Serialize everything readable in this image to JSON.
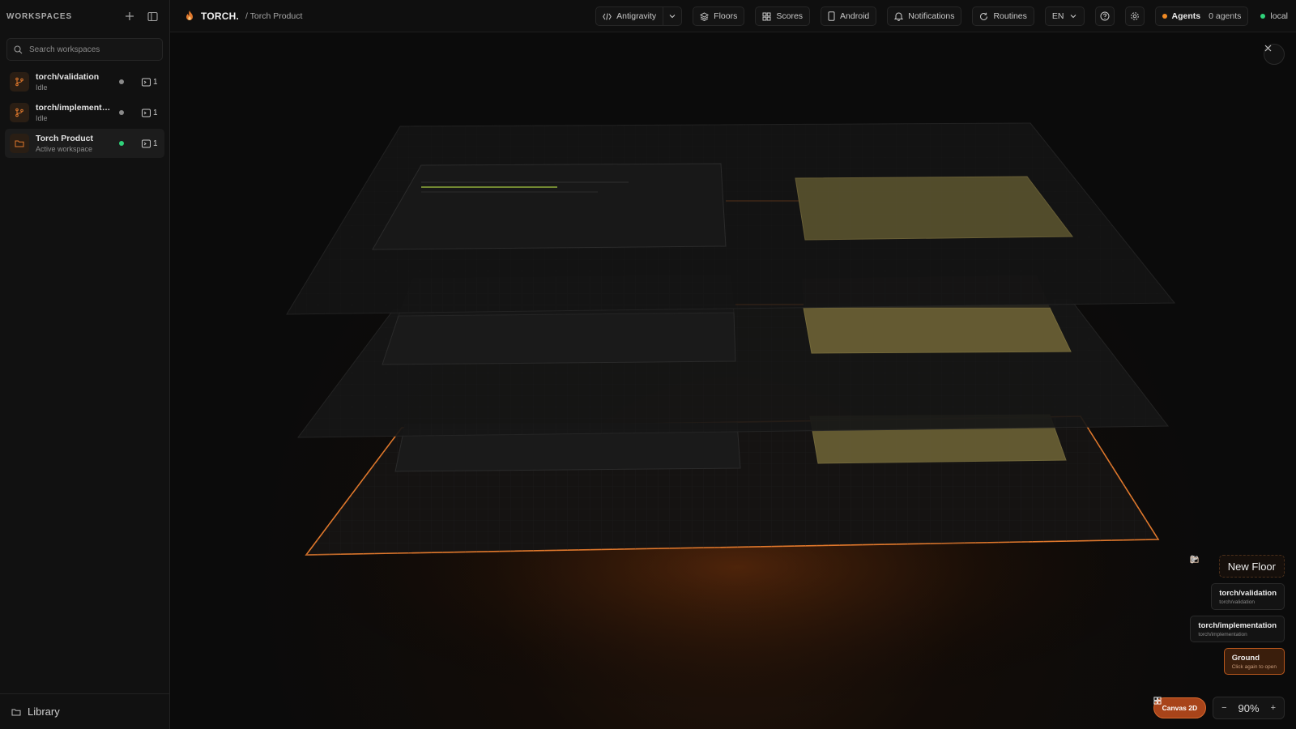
{
  "sidebar": {
    "title": "WORKSPACES",
    "search_placeholder": "Search workspaces",
    "workspaces": [
      {
        "name": "torch/validation",
        "status": "Idle",
        "count": "1"
      },
      {
        "name": "torch/implementati...",
        "status": "Idle",
        "count": "1"
      },
      {
        "name": "Torch Product",
        "status": "Active workspace",
        "count": "1"
      }
    ],
    "footer_label": "Library"
  },
  "topbar": {
    "brand": "TORCH.",
    "breadcrumb": "/ Torch Product",
    "editor": "Antigravity",
    "floors": "Floors",
    "scores": "Scores",
    "android": "Android",
    "notifications": "Notifications",
    "routines": "Routines",
    "language": "EN",
    "agents_label": "Agents",
    "agents_count": "0 agents",
    "env": "local"
  },
  "canvas": {
    "new_floor": "New Floor",
    "floors": [
      {
        "name": "torch/validation",
        "sub": "torch/validation"
      },
      {
        "name": "torch/implementation",
        "sub": "torch/implementation"
      },
      {
        "name": "Ground",
        "sub": "Click again to open"
      }
    ],
    "mode_label": "Canvas 2D",
    "zoom_minus": "−",
    "zoom_value": "90%",
    "zoom_plus": "+"
  },
  "colors": {
    "accent": "#e0782c",
    "status_green": "#2fd27a",
    "agent_orange": "#f08a24"
  },
  "icons": {
    "add": "plus-icon",
    "sidebar_toggle": "panel-icon",
    "search": "search-icon",
    "branch": "git-branch-icon",
    "folder": "folder-icon",
    "terminal": "terminal-icon",
    "code": "code-icon",
    "layers": "layers-icon",
    "grid": "grid-icon",
    "phone": "phone-icon",
    "bell": "bell-icon",
    "refresh": "refresh-icon",
    "help": "help-icon",
    "gear": "gear-icon",
    "close": "close-icon",
    "flame": "flame-icon"
  }
}
